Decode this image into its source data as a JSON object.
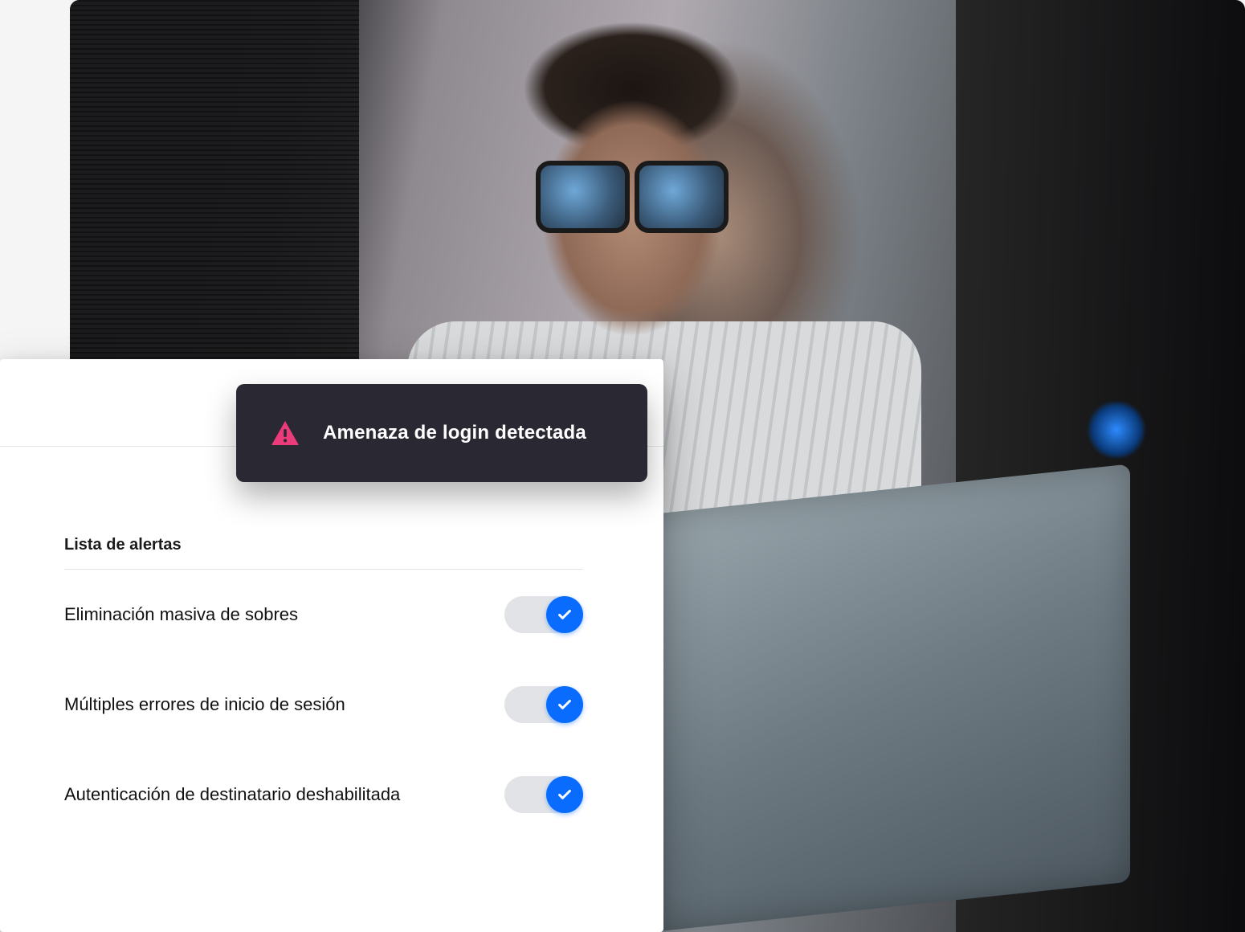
{
  "banner": {
    "message": "Amenaza de login detectada",
    "icon": "warning-triangle",
    "accent_color": "#ec3b7b",
    "bg_color": "#2a2833"
  },
  "alerts": {
    "heading": "Lista de alertas",
    "items": [
      {
        "label": "Eliminación masiva de sobres",
        "enabled": true
      },
      {
        "label": "Múltiples errores de inicio de sesión",
        "enabled": true
      },
      {
        "label": "Autenticación de destinatario deshabilitada",
        "enabled": true
      }
    ]
  },
  "colors": {
    "toggle_on": "#0a6cff",
    "toggle_track": "#e2e3e6"
  }
}
